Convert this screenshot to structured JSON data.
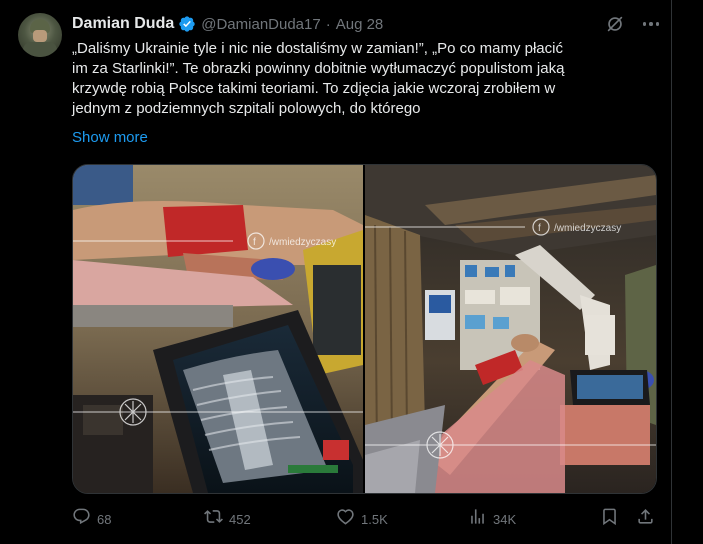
{
  "author": {
    "name": "Damian Duda",
    "handle": "@DamianDuda17",
    "separator": "·",
    "date": "Aug 28"
  },
  "tweet": {
    "text": "„Daliśmy Ukrainie tyle i nic nie dostaliśmy w zamian!”, „Po co mamy płacić\nim za Starlinki!”. Te obrazki powinny dobitnie wytłumaczyć populistom jaką\nkrzywdę robią Polsce takimi teoriami. To zdjęcia jakie wczoraj zrobiłem w\njednym z podziemnych szpitali polowych, do którego",
    "show_more": "Show more"
  },
  "media": {
    "watermark": "/wmiedzyczasy"
  },
  "actions": {
    "replies": "68",
    "reposts": "452",
    "likes": "1.5K",
    "views": "34K"
  },
  "colors": {
    "accent": "#1d9bf0",
    "muted": "#71767b",
    "text": "#e7e9ea",
    "background": "#000000"
  },
  "icons": {
    "verified": "verified-badge-icon",
    "grok": "grok-icon",
    "more": "more-icon",
    "reply": "reply-icon",
    "repost": "repost-icon",
    "like": "like-icon",
    "views": "views-icon",
    "bookmark": "bookmark-icon",
    "share": "share-icon"
  }
}
